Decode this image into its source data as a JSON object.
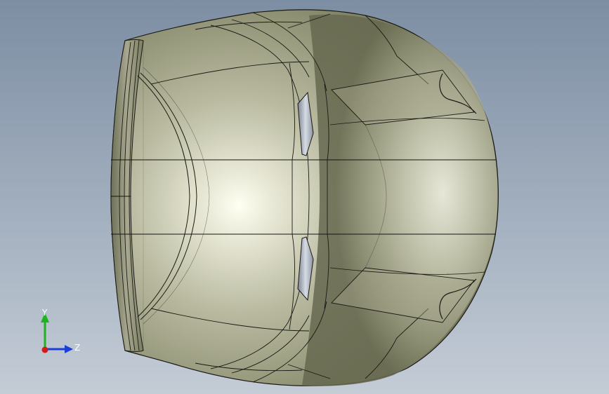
{
  "viewport": {
    "background_top": "#7d8ea3",
    "background_bottom": "#c4ccd6"
  },
  "model": {
    "shell_color": "#8e9073",
    "highlight_color": "#fffff2",
    "edge_color": "#1a1a14"
  },
  "triad": {
    "y_label": "Y",
    "z_label": "Z",
    "y_color": "#1db31d",
    "z_color": "#1a3fd9",
    "x_color": "#d21b1b"
  }
}
